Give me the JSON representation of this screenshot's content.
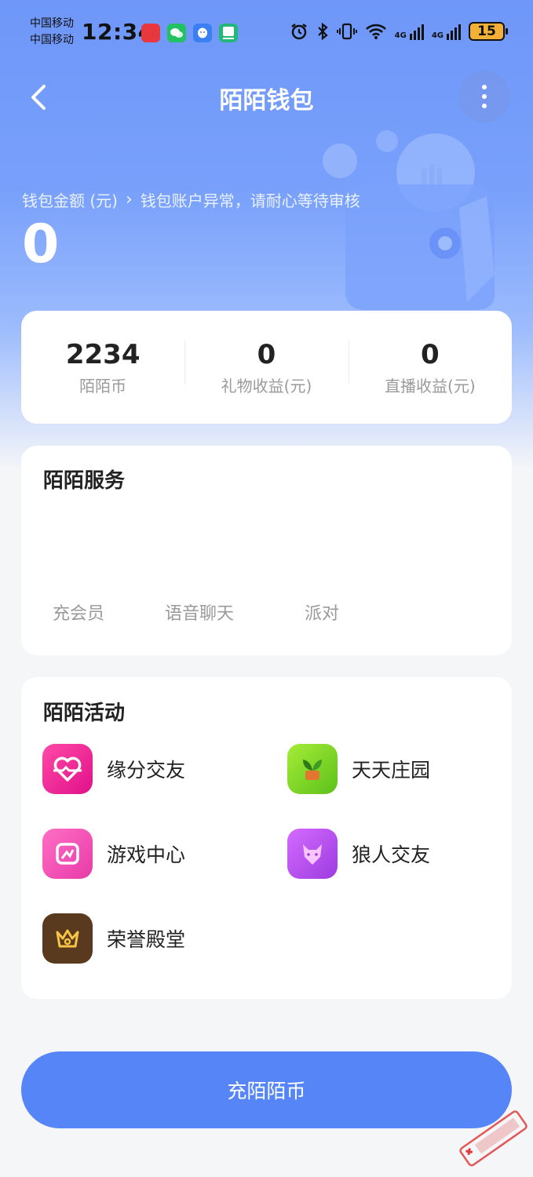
{
  "status_bar": {
    "carrier_top": "中国移动",
    "carrier_bottom": "中国移动",
    "time": "12:34",
    "battery": "15"
  },
  "header": {
    "title": "陌陌钱包"
  },
  "balance": {
    "label": "钱包金额 (元)",
    "notice": "钱包账户异常，请耐心等待审核",
    "value": "0"
  },
  "stats": [
    {
      "value": "2234",
      "label": "陌陌币"
    },
    {
      "value": "0",
      "label": "礼物收益(元)"
    },
    {
      "value": "0",
      "label": "直播收益(元)"
    }
  ],
  "services": {
    "title": "陌陌服务",
    "items": [
      "充会员",
      "语音聊天",
      "派对"
    ]
  },
  "activities": {
    "title": "陌陌活动",
    "items": [
      {
        "label": "缘分交友",
        "icon": "heart-icon",
        "color": "#f0168a"
      },
      {
        "label": "天天庄园",
        "icon": "sprout-icon",
        "color": "#7ed321"
      },
      {
        "label": "游戏中心",
        "icon": "gamepad-icon",
        "color": "#f353b9"
      },
      {
        "label": "狼人交友",
        "icon": "wolf-icon",
        "color": "#b645e5"
      },
      {
        "label": "荣誉殿堂",
        "icon": "crown-icon",
        "color": "#5a3a1e"
      }
    ]
  },
  "footer": {
    "button_label": "充陌陌币"
  },
  "colors": {
    "accent": "#5585f7",
    "header_gradient_top": "#6e97f9"
  }
}
